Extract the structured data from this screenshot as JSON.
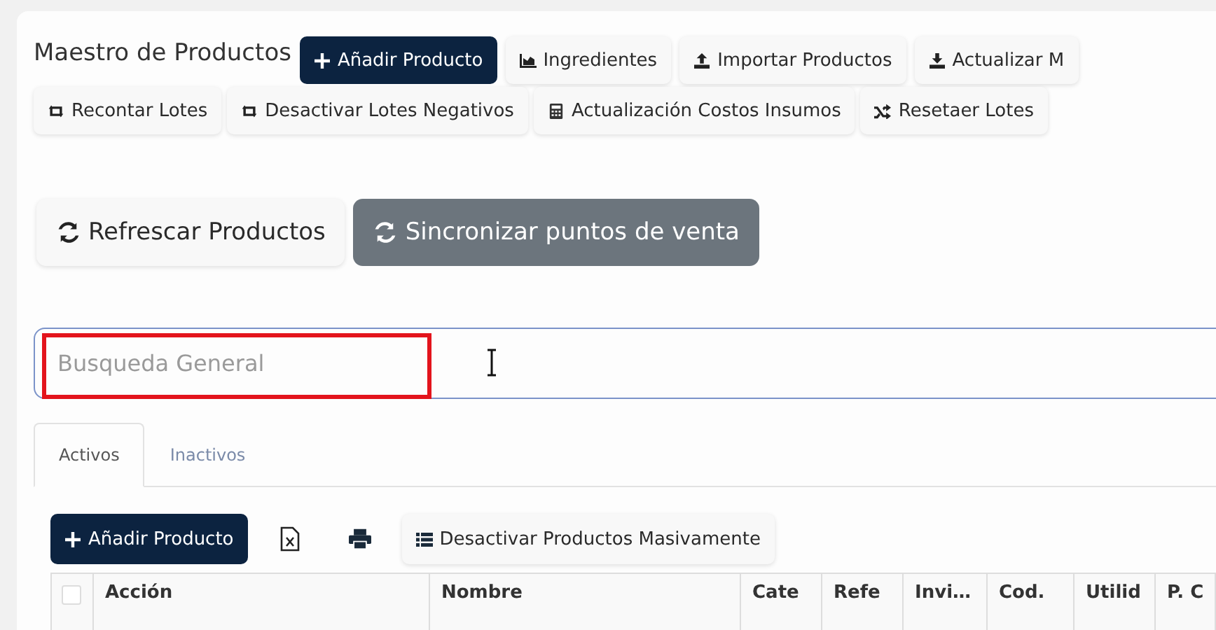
{
  "title": "Maestro de Productos",
  "primary_action": {
    "label": "Añadir Producto"
  },
  "toolbar_row_1": [
    {
      "label": "Ingredientes"
    },
    {
      "label": "Importar Productos"
    },
    {
      "label": "Actualizar M"
    }
  ],
  "toolbar_row_2": [
    {
      "label": "Recontar Lotes"
    },
    {
      "label": "Desactivar Lotes Negativos"
    },
    {
      "label": "Actualización Costos Insumos"
    },
    {
      "label": "Resetaer Lotes"
    }
  ],
  "sync_buttons": [
    {
      "label": "Refrescar Productos",
      "kind": "light"
    },
    {
      "label": "Sincronizar puntos de venta",
      "kind": "dark"
    }
  ],
  "search": {
    "placeholder": "Busqueda General",
    "highlighted": true
  },
  "tabs": [
    {
      "label": "Activos",
      "selected": true
    },
    {
      "label": "Inactivos",
      "selected": false
    }
  ],
  "list_toolbar": [
    {
      "kind": "primary",
      "label": "Añadir Producto"
    },
    {
      "kind": "excel"
    },
    {
      "kind": "print"
    },
    {
      "kind": "light",
      "label": "Desactivar Productos Masivamente"
    }
  ],
  "table": {
    "select_all": {
      "checked": false
    },
    "columns": [
      {
        "label": "Acción"
      },
      {
        "label": "Nombre"
      },
      {
        "label": "Cate"
      },
      {
        "label": "Refe"
      },
      {
        "label": "Invi…"
      },
      {
        "label": "Cod."
      },
      {
        "label": "Utilid"
      },
      {
        "label": "P. C"
      }
    ]
  }
}
